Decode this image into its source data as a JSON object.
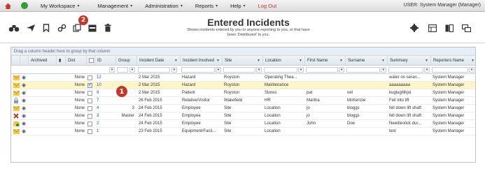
{
  "nav": {
    "items": [
      {
        "label": "My Workspace",
        "caret": true
      },
      {
        "label": "Management",
        "caret": true
      },
      {
        "label": "Administration",
        "caret": true
      },
      {
        "label": "Reports",
        "caret": true
      },
      {
        "label": "Help",
        "caret": true
      }
    ],
    "logout": "Log Out",
    "user": "USER: System Manager (Manager)"
  },
  "toolbar": {
    "title": "Entered Incidents",
    "subtitle_line1": "Shows incidents entered by you or anyone reporting to you, or that have",
    "subtitle_line2": "been 'Distributed' to you.",
    "badge_toolbar": "2",
    "icons_left": [
      "binoculars-icon",
      "send-icon",
      "bookmark-icon",
      "link-icon",
      "copy-icon",
      "inbox-icon",
      "trash-icon"
    ],
    "icons_right": [
      "settings-icon",
      "table-icon",
      "columns-icon",
      "windows-icon"
    ]
  },
  "grid": {
    "group_hint": "Drag a column header here to group by that column",
    "columns": [
      "",
      "",
      "Archived",
      "",
      "Dist",
      "",
      "ID",
      "Group",
      "Incident Date",
      "Incident Involved",
      "Site",
      "Location",
      "First Name",
      "Surname",
      "Summary",
      "Reporters Name"
    ],
    "row_badge": "1",
    "rows": [
      {
        "icon": "envelope-icon",
        "dist": "None",
        "checked": false,
        "id": "12",
        "group": "",
        "date": "2 Mar 2015",
        "involved": "Hazard",
        "site": "Royston",
        "location": "Operating Thea...",
        "first": "",
        "surname": "",
        "summary": "water on seran...",
        "reporter": "System Manager",
        "selected": false
      },
      {
        "icon": "envelope-icon",
        "dist": "None",
        "checked": true,
        "id": "10",
        "group": "",
        "date": "2 Mar 2015",
        "involved": "Hazard",
        "site": "Royston",
        "location": "Maintenance",
        "first": "",
        "surname": "",
        "summary": "aaaaaaaaa",
        "reporter": "System Manager",
        "selected": true
      },
      {
        "icon": "envelope-icon",
        "dist": "None",
        "checked": false,
        "id": "9",
        "group": "",
        "date": "2 Mar 2015",
        "involved": "Patient",
        "site": "Royston",
        "location": "Stores",
        "first": "pat",
        "surname": "nel",
        "summary": "kuglugtlihjoi",
        "reporter": "System Manager",
        "selected": false
      },
      {
        "icon": "lock-icon",
        "dist": "None",
        "checked": false,
        "id": "7",
        "group": "",
        "date": "26 Feb 2015",
        "involved": "Relative/Visitor",
        "site": "Wakefield",
        "location": "HR",
        "first": "Martha",
        "surname": "McKenzie",
        "summary": "Fell into lift",
        "reporter": "System Manager",
        "selected": false
      },
      {
        "icon": "envelope-icon",
        "dist": "None",
        "checked": false,
        "id": "4",
        "group": "3",
        "date": "24 Feb 2015",
        "involved": "Employee",
        "site": "Site",
        "location": "Location",
        "first": "jo",
        "surname": "bloggs",
        "summary": "fell down lift shaft",
        "reporter": "System Manager",
        "selected": false
      },
      {
        "icon": "close-icon",
        "dist": "None",
        "checked": false,
        "id": "3",
        "group": "Master",
        "date": "24 Feb 2015",
        "involved": "Employee",
        "site": "Site",
        "location": "Location",
        "first": "jo",
        "surname": "bloggs",
        "summary": "fell down lift shaft",
        "reporter": "System Manager",
        "selected": false
      },
      {
        "icon": "envelope-open-icon",
        "dist": "None",
        "checked": false,
        "id": "2",
        "group": "",
        "date": "24 Feb 2015",
        "involved": "Employee",
        "site": "Site",
        "location": "Location",
        "first": "John",
        "surname": "Doe",
        "summary": "Needlestick dur...",
        "reporter": "System Manager",
        "selected": false
      },
      {
        "icon": "envelope-icon",
        "dist": "None",
        "checked": false,
        "id": "1",
        "group": "",
        "date": "23 Feb 2015",
        "involved": "Equipment/Facil...",
        "site": "Site",
        "location": "Location",
        "first": "",
        "surname": "",
        "summary": "test",
        "reporter": "System Manager",
        "selected": false
      }
    ]
  },
  "colors": {
    "accent": "#c0392b",
    "link": "#2255aa",
    "selected_row": "#fff6c8",
    "header": "#dfe6ee"
  }
}
